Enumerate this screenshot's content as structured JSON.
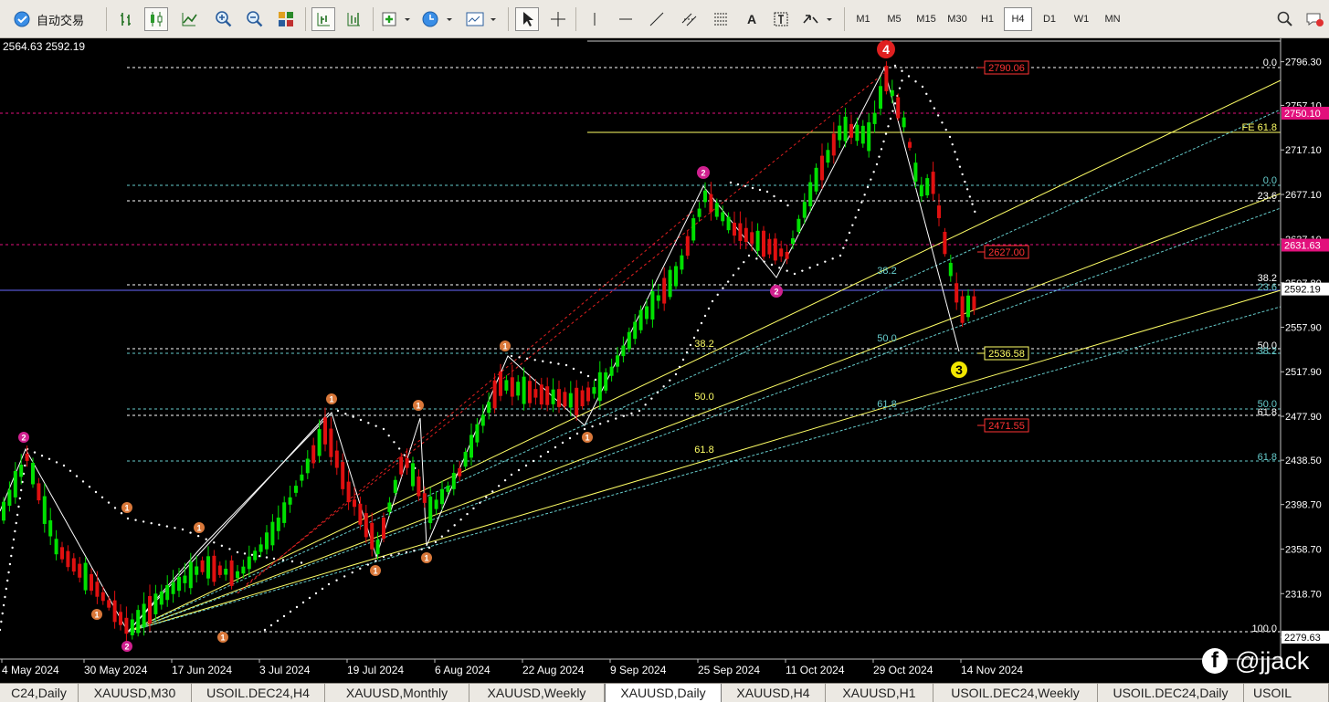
{
  "toolbar": {
    "auto_trading_label": "自动交易",
    "timeframes": [
      "M1",
      "M5",
      "M15",
      "M30",
      "H1",
      "H4",
      "D1",
      "W1",
      "MN"
    ],
    "active_timeframe": "H4",
    "text_tool_label": "A"
  },
  "chart": {
    "ohlc_text": "2564.63 2592.19",
    "price_axis": {
      "labels": [
        "2796.30",
        "2757.10",
        "2717.10",
        "2677.10",
        "2637.10",
        "2597.80",
        "2557.90",
        "2517.90",
        "2477.90",
        "2438.50",
        "2398.70",
        "2358.70",
        "2318.70",
        "2279.63"
      ]
    },
    "price_tags": [
      {
        "text": "2750.10",
        "color": "#e2107c"
      },
      {
        "text": "2631.63",
        "color": "#e2107c"
      },
      {
        "text": "2592.19",
        "color": "#ffffff"
      },
      {
        "text": "2279.63",
        "color": "#ffffff"
      }
    ],
    "date_axis": [
      "4 May 2024",
      "30 May 2024",
      "17 Jun 2024",
      "3 Jul 2024",
      "19 Jul 2024",
      "6 Aug 2024",
      "22 Aug 2024",
      "9 Sep 2024",
      "25 Sep 2024",
      "11 Oct 2024",
      "29 Oct 2024",
      "14 Nov 2024"
    ],
    "level_boxes": [
      {
        "text": "2790.06",
        "color": "#ff3333"
      },
      {
        "text": "2627.00",
        "color": "#ff3333"
      },
      {
        "text": "2536.58",
        "color": "#ffff66"
      },
      {
        "text": "2471.55",
        "color": "#ff3333"
      }
    ],
    "fib_labels_right": [
      {
        "text": "0.0",
        "color": "#ffffff"
      },
      {
        "text": "FE 61.8",
        "color": "#ffff66"
      },
      {
        "text": "0.0",
        "color": "#66cccc"
      },
      {
        "text": "23.6",
        "color": "#ffffff"
      },
      {
        "text": "38.2",
        "color": "#ffffff"
      },
      {
        "text": "23.6",
        "color": "#66cccc"
      },
      {
        "text": "50.0",
        "color": "#ffffff"
      },
      {
        "text": "38.2",
        "color": "#66cccc"
      },
      {
        "text": "50.0",
        "color": "#66cccc"
      },
      {
        "text": "61.8",
        "color": "#ffffff"
      },
      {
        "text": "61.8",
        "color": "#66cccc"
      },
      {
        "text": "100.0",
        "color": "#ffffff"
      }
    ],
    "fib_labels_inner": [
      {
        "text": "38.2",
        "color": "#ffff66"
      },
      {
        "text": "50.0",
        "color": "#ffff66"
      },
      {
        "text": "61.8",
        "color": "#ffff66"
      },
      {
        "text": "38.2",
        "color": "#66cccc"
      },
      {
        "text": "50.0",
        "color": "#66cccc"
      },
      {
        "text": "61.8",
        "color": "#66cccc"
      }
    ],
    "wave_markers": [
      {
        "text": "2",
        "color": "#d0208f"
      },
      {
        "text": "1",
        "color": "#d9783a"
      },
      {
        "text": "1",
        "color": "#d9783a"
      },
      {
        "text": "2",
        "color": "#d0208f"
      },
      {
        "text": "1",
        "color": "#d9783a"
      },
      {
        "text": "1",
        "color": "#d9783a"
      },
      {
        "text": "1",
        "color": "#d9783a"
      },
      {
        "text": "1",
        "color": "#d9783a"
      },
      {
        "text": "1",
        "color": "#d9783a"
      },
      {
        "text": "1",
        "color": "#d9783a"
      },
      {
        "text": "1",
        "color": "#d9783a"
      },
      {
        "text": "1",
        "color": "#d9783a"
      },
      {
        "text": "2",
        "color": "#d0208f"
      },
      {
        "text": "2",
        "color": "#d0208f"
      },
      {
        "text": "4",
        "color": "#e02020"
      },
      {
        "text": "3",
        "color": "#f2e600"
      }
    ]
  },
  "tabs": [
    {
      "label": "C24,Daily"
    },
    {
      "label": "XAUUSD,M30"
    },
    {
      "label": "USOIL.DEC24,H4"
    },
    {
      "label": "XAUUSD,Monthly"
    },
    {
      "label": "XAUUSD,Weekly"
    },
    {
      "label": "XAUUSD,Daily"
    },
    {
      "label": "XAUUSD,H4"
    },
    {
      "label": "XAUUSD,H1"
    },
    {
      "label": "USOIL.DEC24,Weekly"
    },
    {
      "label": "USOIL.DEC24,Daily"
    },
    {
      "label": "USOIL"
    }
  ],
  "active_tab": "XAUUSD,Daily",
  "watermark": {
    "icon": "facebook-icon",
    "text": "@jjack"
  },
  "colors": {
    "bull": "#00e000",
    "bear": "#e01010",
    "background": "#000000"
  }
}
